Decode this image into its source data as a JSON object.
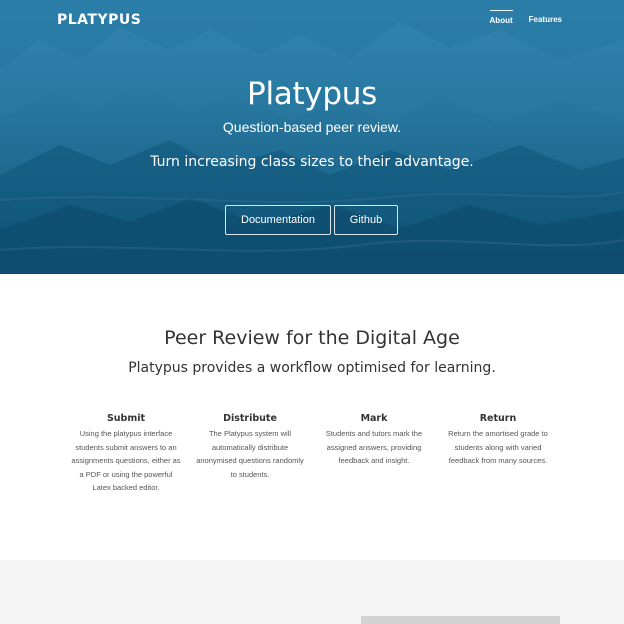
{
  "nav": {
    "brand": "PLATYPUS",
    "links": [
      {
        "label": "About"
      },
      {
        "label": "Features"
      }
    ]
  },
  "hero": {
    "title": "Platypus",
    "subtitle": "Question-based peer review.",
    "tagline": "Turn increasing class sizes to their advantage.",
    "buttons": [
      {
        "label": "Documentation"
      },
      {
        "label": "Github"
      }
    ],
    "colors": {
      "overlay": "#1a6a92",
      "text": "#ffffff"
    }
  },
  "intro": {
    "title": "Peer Review for the Digital Age",
    "subtitle": "Platypus provides a workflow optimised for learning."
  },
  "features": [
    {
      "title": "Submit",
      "lines": [
        "Using the platypus interface",
        "students submit answers to an",
        "assignments questions, either as",
        "a PDF or using the powerful",
        "Latex backed editor."
      ]
    },
    {
      "title": "Distribute",
      "lines": [
        "The Platypus system will",
        "automatically distribute",
        "anonymised questions randomly",
        "to students."
      ]
    },
    {
      "title": "Mark",
      "lines": [
        "Students and tutors mark the",
        "assigned answers, providing",
        "feedback and insight."
      ]
    },
    {
      "title": "Return",
      "lines": [
        "Return the amortised grade to",
        "students along with varied",
        "feedback from many sources."
      ]
    }
  ]
}
